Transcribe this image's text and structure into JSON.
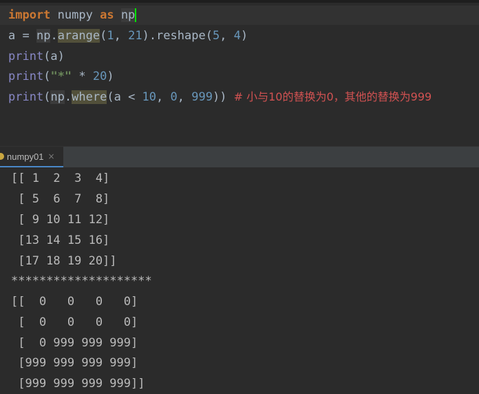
{
  "editor": {
    "line1": {
      "kw_import": "import",
      "module": " numpy ",
      "kw_as": "as",
      "space": " ",
      "alias": "np"
    },
    "line2": {
      "prefix": "a = ",
      "np": "np",
      "dot": ".",
      "fn": "arange",
      "open": "(",
      "arg1": "1",
      "comma": ", ",
      "arg2": "21",
      "rest": ").reshape(",
      "arg3": "5",
      "comma2": ", ",
      "arg4": "4",
      "close": ")"
    },
    "line3": {
      "fn": "print",
      "args": "(a)"
    },
    "line4": {
      "fn": "print",
      "open": "(",
      "str": "\"*\"",
      "op": " * ",
      "num": "20",
      "close": ")"
    },
    "line5": {
      "fn": "print",
      "open": "(",
      "np": "np",
      "dot": ".",
      "where": "where",
      "mid": "(a < ",
      "n1": "10",
      "c1": ", ",
      "n2": "0",
      "c2": ", ",
      "n3": "999",
      "close": "))",
      "comment": "  # 小与10的替换为0，其他的替换为999"
    }
  },
  "run_tab": {
    "label": "numpy01",
    "close": "×"
  },
  "console": {
    "lines": [
      "[[ 1  2  3  4]",
      " [ 5  6  7  8]",
      " [ 9 10 11 12]",
      " [13 14 15 16]",
      " [17 18 19 20]]",
      "********************",
      "[[  0   0   0   0]",
      " [  0   0   0   0]",
      " [  0 999 999 999]",
      " [999 999 999 999]",
      " [999 999 999 999]]"
    ]
  },
  "colors": {
    "background": "#2b2b2b",
    "keyword": "#cc7832",
    "number": "#6897bb",
    "comment": "#d25252",
    "string": "#6a8759",
    "output": "#bbbbbb"
  }
}
